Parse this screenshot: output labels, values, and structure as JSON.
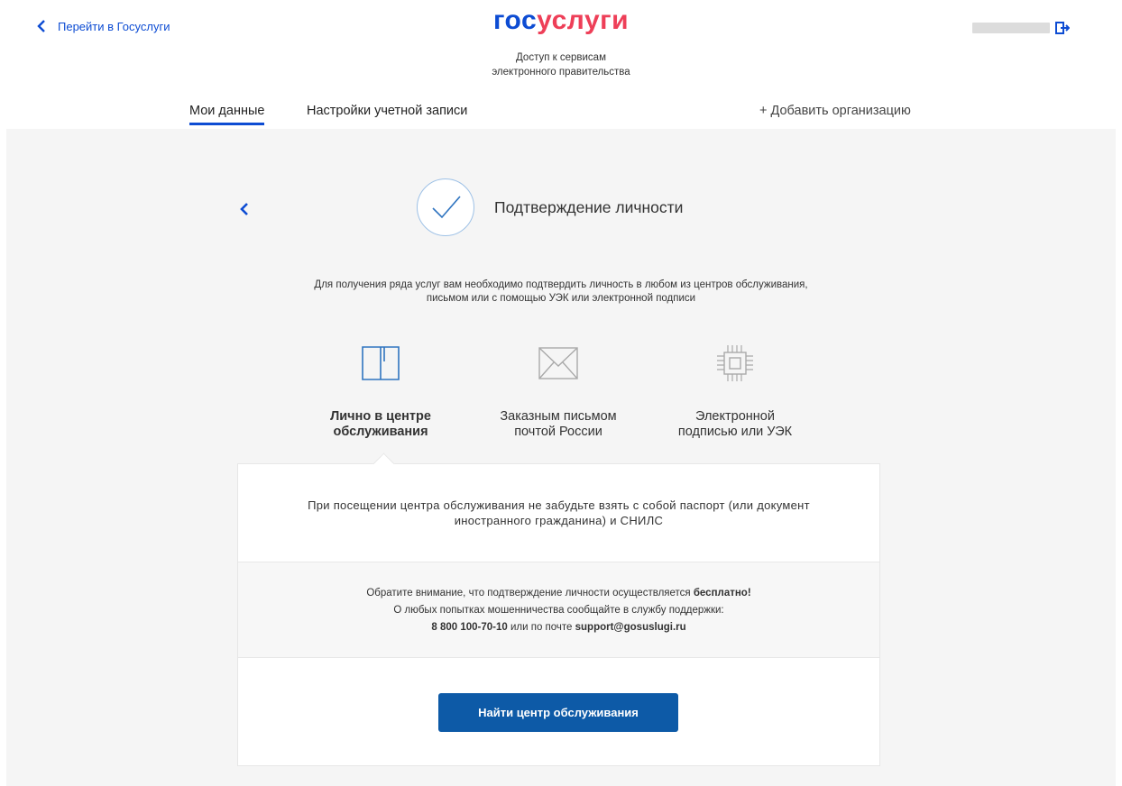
{
  "header": {
    "back_link": "Перейти в Госуслуги",
    "logo_part1": "гос",
    "logo_part2": "услуги",
    "tagline_line1": "Доступ к сервисам",
    "tagline_line2": "электронного правительства",
    "icons": {
      "back": "chevron-left-icon",
      "logout": "logout-icon"
    }
  },
  "tabs": [
    {
      "label": "Мои данные",
      "active": true
    },
    {
      "label": "Настройки учетной записи",
      "active": false
    }
  ],
  "add_org": "+ Добавить организацию",
  "step": {
    "title": "Подтверждение личности",
    "icon": "checkmark-icon"
  },
  "intro": {
    "line1": "Для получения ряда услуг вам необходимо подтвердить личность в любом из центров обслуживания,",
    "line2": "письмом или с помощью УЭК или электронной подписи"
  },
  "methods": [
    {
      "line1": "Лично в центре",
      "line2": "обслуживания",
      "icon": "book-icon",
      "active": true
    },
    {
      "line1": "Заказным письмом",
      "line2": "почтой России",
      "icon": "envelope-icon",
      "active": false
    },
    {
      "line1": "Электронной",
      "line2": "подписью или УЭК",
      "icon": "chip-icon",
      "active": false
    }
  ],
  "card": {
    "reminder_line1": "При посещении центра обслуживания не забудьте взять с собой паспорт (или документ",
    "reminder_line2": "иностранного гражданина) и СНИЛС",
    "notice_line1_prefix": "Обратите внимание, что подтверждение личности осуществляется ",
    "notice_line1_bold": "бесплатно!",
    "notice_line2": "О любых попытках мошенничества сообщайте в службу поддержки:",
    "phone": "8 800 100-70-10",
    "or_email": " или по почте ",
    "email": "support@gosuslugi.ru",
    "button": "Найти центр обслуживания"
  },
  "colors": {
    "accent": "#0d4cd3",
    "logo_red": "#ee3f58",
    "button": "#0d5aa7",
    "background": "#f5f5f5"
  }
}
